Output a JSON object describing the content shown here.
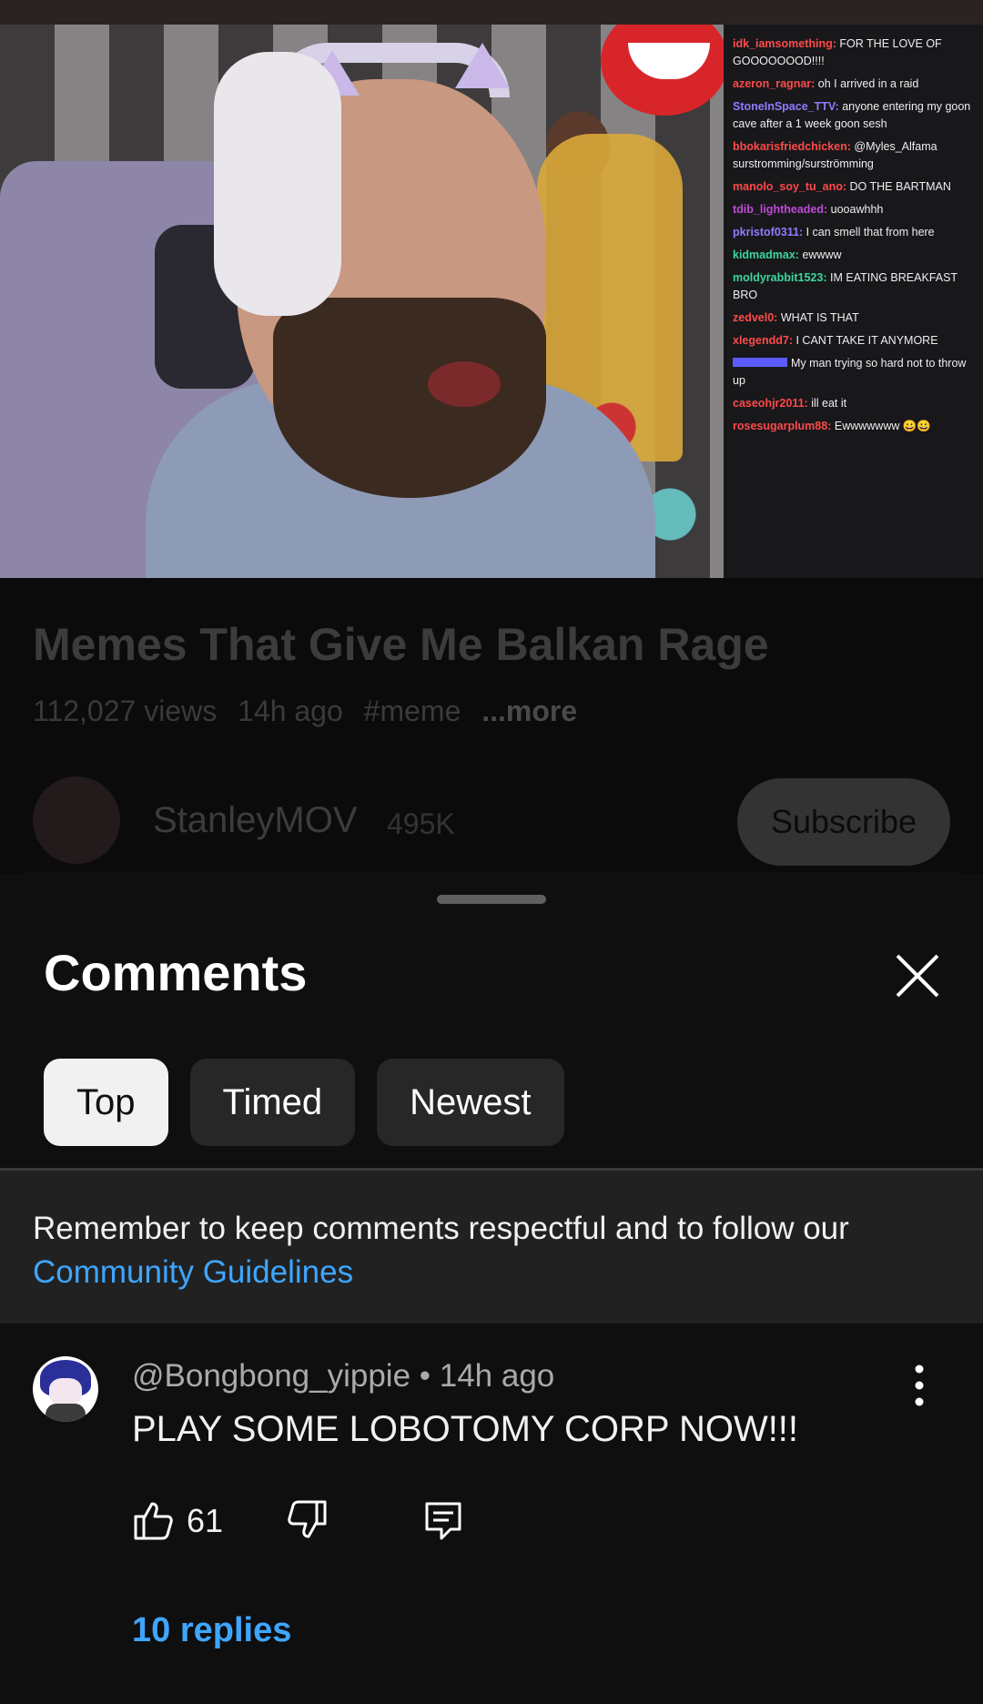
{
  "video": {
    "chat": [
      {
        "user": "idk_iamsomething:",
        "user_color": "#ff4a4a",
        "text": "FOR THE LOVE OF GOOOOOOOD!!!!"
      },
      {
        "user": "azeron_ragnar:",
        "user_color": "#ff4a4a",
        "text": "oh I arrived in a raid"
      },
      {
        "user": "StoneInSpace_TTV:",
        "user_color": "#8e7cff",
        "text": "anyone entering my goon cave after a 1 week goon sesh"
      },
      {
        "user": "bbokarisfriedchicken:",
        "user_color": "#ff4a4a",
        "text": "@Myles_Alfama surstromming/surströmming"
      },
      {
        "user": "manolo_soy_tu_ano:",
        "user_color": "#ff4a4a",
        "text": "DO THE BARTMAN"
      },
      {
        "user": "tdib_lightheaded:",
        "user_color": "#c04ad8",
        "text": "uooawhhh"
      },
      {
        "user": "pkristof0311:",
        "user_color": "#8e7cff",
        "text": "I can smell that from here"
      },
      {
        "user": "kidmadmax:",
        "user_color": "#3bd6a0",
        "text": "ewwww"
      },
      {
        "user": "moldyrabbit1523:",
        "user_color": "#3bd6a0",
        "text": "IM EATING BREAKFAST BRO"
      },
      {
        "user": "zedvel0:",
        "user_color": "#ff4a4a",
        "text": "WHAT IS THAT"
      },
      {
        "user": "xlegendd7:",
        "user_color": "#ff4a4a",
        "text": "I CANT TAKE IT ANYMORE"
      },
      {
        "user": "",
        "user_color": "#5b5bff",
        "text": "My man trying so hard not to throw up"
      },
      {
        "user": "caseohjr2011:",
        "user_color": "#ff4a4a",
        "text": "ill eat it"
      },
      {
        "user": "rosesugarplum88:",
        "user_color": "#ff4a4a",
        "text": "Ewwwwwww 😀😀"
      }
    ],
    "progress_fraction": 0.4
  },
  "info": {
    "title": "Memes That Give Me Balkan Rage",
    "views": "112,027 views",
    "age": "14h ago",
    "hashtag": "#meme",
    "more": "...more",
    "channel_name": "StanleyMOV",
    "channel_subs": "495K",
    "subscribe_label": "Subscribe"
  },
  "comments": {
    "title": "Comments",
    "close_icon": "close-icon",
    "filters": [
      "Top",
      "Timed",
      "Newest"
    ],
    "active_filter": "Top",
    "notice_text": "Remember to keep comments respectful and to follow our ",
    "notice_link": "Community Guidelines",
    "items": [
      {
        "author": "@Bongbong_yippie",
        "separator": " • ",
        "time": "14h ago",
        "text": "PLAY SOME LOBOTOMY CORP NOW!!!",
        "likes": "61",
        "replies_label": "10 replies"
      }
    ]
  },
  "colors": {
    "background": "#0f0f0f",
    "chip_active": "#f1f1f1",
    "chip": "#272727",
    "link": "#3ea6ff",
    "notice_bg": "#212121"
  }
}
